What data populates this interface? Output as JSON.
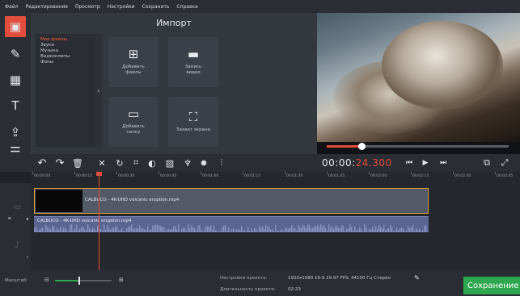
{
  "menu": [
    "Файл",
    "Редактирование",
    "Просмотр",
    "Настройки",
    "Сохранить",
    "Справка"
  ],
  "left_tools": [
    {
      "icon": "film-import-icon",
      "glyph": "▣"
    },
    {
      "icon": "magic-wand-icon",
      "glyph": "✎"
    },
    {
      "icon": "transitions-icon",
      "glyph": "▦"
    },
    {
      "icon": "text-icon",
      "glyph": "T"
    },
    {
      "icon": "stickers-icon",
      "glyph": "⇪"
    },
    {
      "icon": "more-icon",
      "glyph": "☰"
    }
  ],
  "import": {
    "title": "Импорт",
    "categories": [
      "Мои файлы",
      "Звуки",
      "Музыка",
      "Видеоклипы",
      "Фоны"
    ],
    "tiles": [
      {
        "icon": "add-files-icon",
        "glyph": "⊞",
        "label": "Добавить\nфайлы"
      },
      {
        "icon": "record-video-icon",
        "glyph": "▬",
        "label": "Запись\nвидео"
      },
      {
        "icon": "add-folder-icon",
        "glyph": "▭",
        "label": "Добавить\nпапку"
      },
      {
        "icon": "screen-capture-icon",
        "glyph": "⛶",
        "label": "Захват экрана"
      }
    ],
    "collapse_glyph": "‹"
  },
  "preview": {
    "progress": 0.19
  },
  "edit_tools": [
    {
      "icon": "undo-icon",
      "glyph": "↶"
    },
    {
      "icon": "redo-icon",
      "glyph": "↷"
    },
    {
      "icon": "delete-icon",
      "glyph": "🗑"
    },
    {
      "icon": "cut-icon",
      "glyph": "✕"
    },
    {
      "icon": "rotate-icon",
      "glyph": "↻"
    },
    {
      "icon": "crop-icon",
      "glyph": "⌗"
    },
    {
      "icon": "color-adjust-icon",
      "glyph": "◐"
    },
    {
      "icon": "insert-image-icon",
      "glyph": "▨"
    },
    {
      "icon": "microphone-icon",
      "glyph": "♆"
    },
    {
      "icon": "settings-icon",
      "glyph": "✹"
    },
    {
      "icon": "equalizer-icon",
      "glyph": "⫶"
    }
  ],
  "timecode": {
    "main": "00:00:",
    "fraction": "24.300"
  },
  "playback": [
    {
      "icon": "previous-frame-icon",
      "glyph": "⏮"
    },
    {
      "icon": "play-icon",
      "glyph": "▶"
    },
    {
      "icon": "next-frame-icon",
      "glyph": "⏭"
    }
  ],
  "view_tools": [
    {
      "icon": "export-frame-icon",
      "glyph": "⧉"
    },
    {
      "icon": "fullscreen-icon",
      "glyph": "⤢"
    }
  ],
  "ruler": [
    "00:00:00",
    "00:00:15",
    "00:00:30",
    "00:00:45",
    "00:01:00",
    "00:01:15",
    "00:01:30",
    "00:01:45",
    "00:02:00",
    "00:02:15",
    "00:02:30",
    "00:02:45"
  ],
  "tracks": {
    "video_clip": "CALBUCO - 4K-UHD volcanic eruption.mp4",
    "audio_clip": "CALBUCO - 4K-UHD volcanic eruption.mp4"
  },
  "bottom": {
    "zoom_label": "Масштаб:",
    "zoom_level": 0.42,
    "project_settings_label": "Настройки проекта:",
    "project_settings_value": "1920x1080 16:9 29.97 FPS, 44100 Гц Стерео",
    "duration_label": "Длительность проекта:",
    "duration_value": "02:23",
    "save_label": "Сохранение"
  },
  "colors": {
    "accent": "#e24d3e",
    "save": "#2ea84f",
    "clip_border": "#e0a13a",
    "audio": "#5a6592"
  }
}
